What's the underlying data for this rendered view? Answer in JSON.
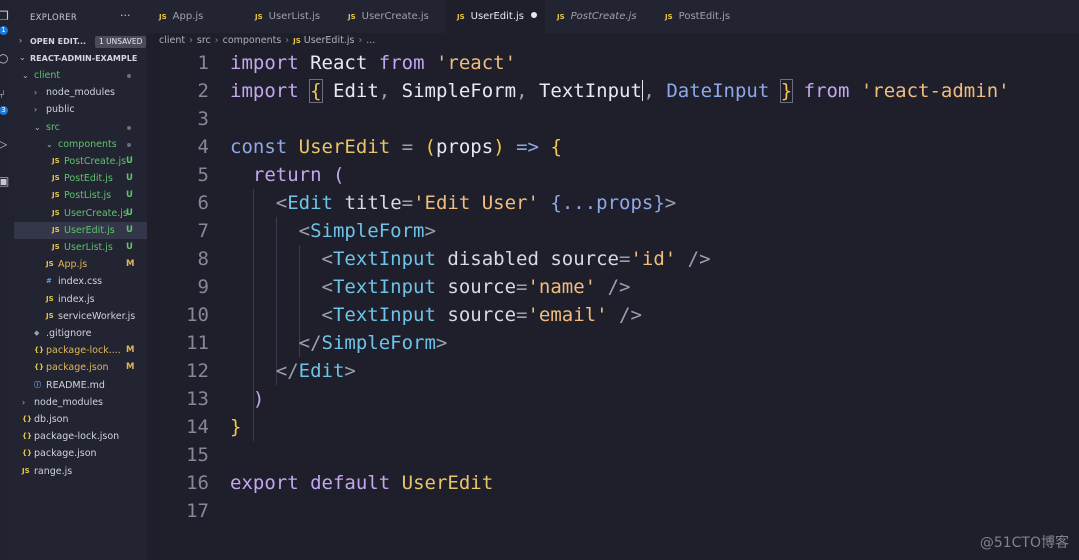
{
  "sidebar": {
    "title": "EXPLORER",
    "more": "···",
    "open_editors_label": "OPEN EDIT...",
    "unsaved_badge": "1 UNSAVED",
    "project_label": "REACT-ADMIN-EXAMPLE",
    "tree": [
      {
        "label": "client",
        "type": "folder",
        "open": true,
        "depth": 1,
        "dot": true
      },
      {
        "label": "node_modules",
        "type": "folder",
        "open": false,
        "depth": 2
      },
      {
        "label": "public",
        "type": "folder",
        "open": false,
        "depth": 2
      },
      {
        "label": "src",
        "type": "folder",
        "open": true,
        "depth": 2,
        "dot": true
      },
      {
        "label": "components",
        "type": "folder",
        "open": true,
        "depth": 3,
        "dot": true
      },
      {
        "label": "PostCreate.js",
        "type": "js",
        "depth": 4,
        "status": "U"
      },
      {
        "label": "PostEdit.js",
        "type": "js",
        "depth": 4,
        "status": "U"
      },
      {
        "label": "PostList.js",
        "type": "js",
        "depth": 4,
        "status": "U"
      },
      {
        "label": "UserCreate.js",
        "type": "js",
        "depth": 4,
        "status": "U"
      },
      {
        "label": "UserEdit.js",
        "type": "js",
        "depth": 4,
        "status": "U",
        "selected": true
      },
      {
        "label": "UserList.js",
        "type": "js",
        "depth": 4,
        "status": "U"
      },
      {
        "label": "App.js",
        "type": "js",
        "depth": 3,
        "status": "M"
      },
      {
        "label": "index.css",
        "type": "css",
        "depth": 3
      },
      {
        "label": "index.js",
        "type": "js",
        "depth": 3
      },
      {
        "label": "serviceWorker.js",
        "type": "js",
        "depth": 3
      },
      {
        "label": ".gitignore",
        "type": "git",
        "depth": 2
      },
      {
        "label": "package-lock....",
        "type": "json",
        "depth": 2,
        "status": "M"
      },
      {
        "label": "package.json",
        "type": "json",
        "depth": 2,
        "status": "M"
      },
      {
        "label": "README.md",
        "type": "info",
        "depth": 2
      },
      {
        "label": "node_modules",
        "type": "folder",
        "open": false,
        "depth": 1
      },
      {
        "label": "db.json",
        "type": "json",
        "depth": 1
      },
      {
        "label": "package-lock.json",
        "type": "json",
        "depth": 1
      },
      {
        "label": "package.json",
        "type": "json",
        "depth": 1
      },
      {
        "label": "range.js",
        "type": "js",
        "depth": 1
      }
    ]
  },
  "activity": {
    "badges": [
      "1",
      "3"
    ]
  },
  "tabs": [
    {
      "label": "App.js",
      "active": false,
      "preview": false
    },
    {
      "label": "UserList.js",
      "active": false,
      "preview": false
    },
    {
      "label": "UserCreate.js",
      "active": false,
      "preview": false
    },
    {
      "label": "UserEdit.js",
      "active": true,
      "preview": false,
      "unsaved": true
    },
    {
      "label": "PostCreate.js",
      "active": false,
      "preview": true
    },
    {
      "label": "PostEdit.js",
      "active": false,
      "preview": false
    }
  ],
  "breadcrumb": {
    "items": [
      "client",
      "src",
      "components",
      "UserEdit.js",
      "..."
    ]
  },
  "file_type_label": "JS",
  "code": {
    "line_numbers": [
      "1",
      "2",
      "3",
      "4",
      "5",
      "6",
      "7",
      "8",
      "9",
      "10",
      "11",
      "12",
      "13",
      "14",
      "15",
      "16",
      "17"
    ],
    "l1": {
      "import": "import",
      "name": "React",
      "from": "from",
      "str": "'react'"
    },
    "l2": {
      "import": "import",
      "open": "{",
      "edit": "Edit",
      "c1": ",",
      "sf": "SimpleForm",
      "c2": ",",
      "ti": "TextInput",
      "c3": ",",
      "di": "DateInput",
      "close": "}",
      "from": "from",
      "str": "'react-admin'"
    },
    "l4": {
      "const": "const",
      "name": "UserEdit",
      "eq": "=",
      "po": "(",
      "props": "props",
      "pc": ")",
      "arrow": "=>",
      "brace": "{"
    },
    "l5": {
      "ret": "return",
      "paren": "("
    },
    "l6": {
      "lt": "<",
      "tag": "Edit",
      "attr": "title",
      "eq": "=",
      "str": "'Edit User'",
      "spread": "{...props}",
      "gt": ">"
    },
    "l7": {
      "lt": "<",
      "tag": "SimpleForm",
      "gt": ">"
    },
    "l8": {
      "lt": "<",
      "tag": "TextInput",
      "a1": "disabled",
      "a2": "source",
      "eq": "=",
      "str": "'id'",
      "close": "/>"
    },
    "l9": {
      "lt": "<",
      "tag": "TextInput",
      "a2": "source",
      "eq": "=",
      "str": "'name'",
      "close": "/>"
    },
    "l10": {
      "lt": "<",
      "tag": "TextInput",
      "a2": "source",
      "eq": "=",
      "str": "'email'",
      "close": "/>"
    },
    "l11": {
      "lt": "</",
      "tag": "SimpleForm",
      "gt": ">"
    },
    "l12": {
      "lt": "</",
      "tag": "Edit",
      "gt": ">"
    },
    "l13": {
      "paren": ")"
    },
    "l14": {
      "brace": "}"
    },
    "l16": {
      "export": "export",
      "default": "default",
      "name": "UserEdit"
    }
  },
  "watermark": "@51CTO博客"
}
